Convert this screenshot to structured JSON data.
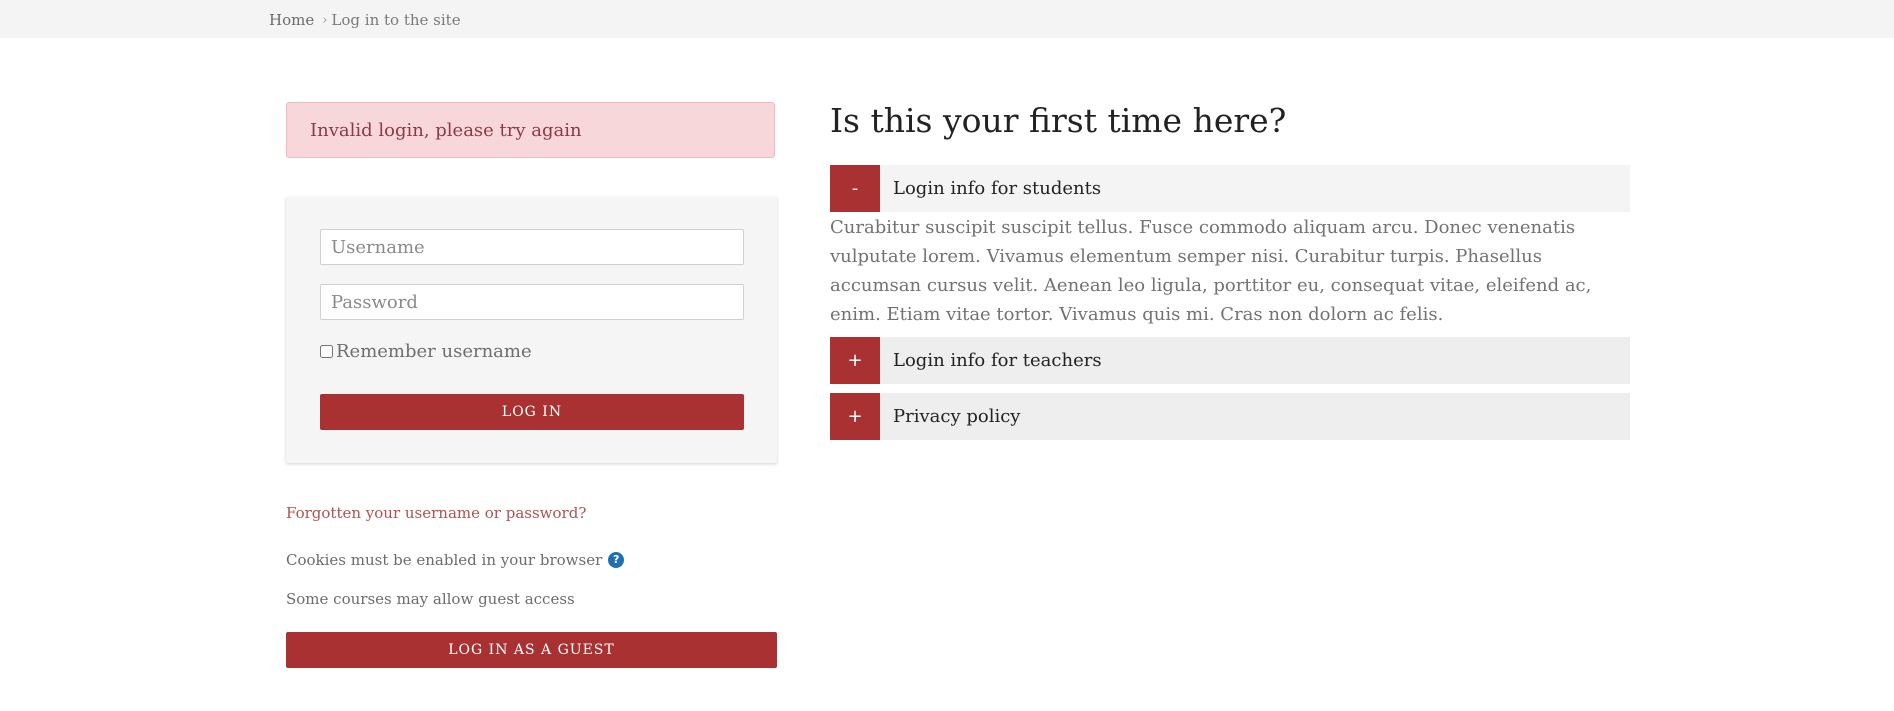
{
  "breadcrumb": {
    "home": "Home",
    "separator": "›",
    "current": "Log in to the site"
  },
  "alert": {
    "message": "Invalid login, please try again"
  },
  "login_form": {
    "username_placeholder": "Username",
    "password_placeholder": "Password",
    "remember_label": "Remember username",
    "remember_checked": false,
    "login_button": "Log in"
  },
  "links": {
    "forgot": "Forgotten your username or password?"
  },
  "cookies_note": "Cookies must be enabled in your browser",
  "guest": {
    "note": "Some courses may allow guest access",
    "button": "Log in as a guest"
  },
  "intro": {
    "heading": "Is this your first time here?"
  },
  "accordion": [
    {
      "toggle": "-",
      "title": "Login info for students",
      "expanded": true,
      "body": "Curabitur suscipit suscipit tellus. Fusce commodo aliquam arcu. Donec venenatis vulputate lorem. Vivamus elementum semper nisi. Curabitur turpis. Phasellus accumsan cursus velit. Aenean leo ligula, porttitor eu, consequat vitae, eleifend ac, enim. Etiam vitae tortor. Vivamus quis mi. Cras non dolorn ac felis."
    },
    {
      "toggle": "+",
      "title": "Login info for teachers",
      "expanded": false
    },
    {
      "toggle": "+",
      "title": "Privacy policy",
      "expanded": false
    }
  ],
  "icons": {
    "help": "?"
  },
  "colors": {
    "brand": "#a93131",
    "alert_bg": "#f8d7da",
    "link": "#b0524e",
    "help_icon": "#1f6fb3"
  }
}
